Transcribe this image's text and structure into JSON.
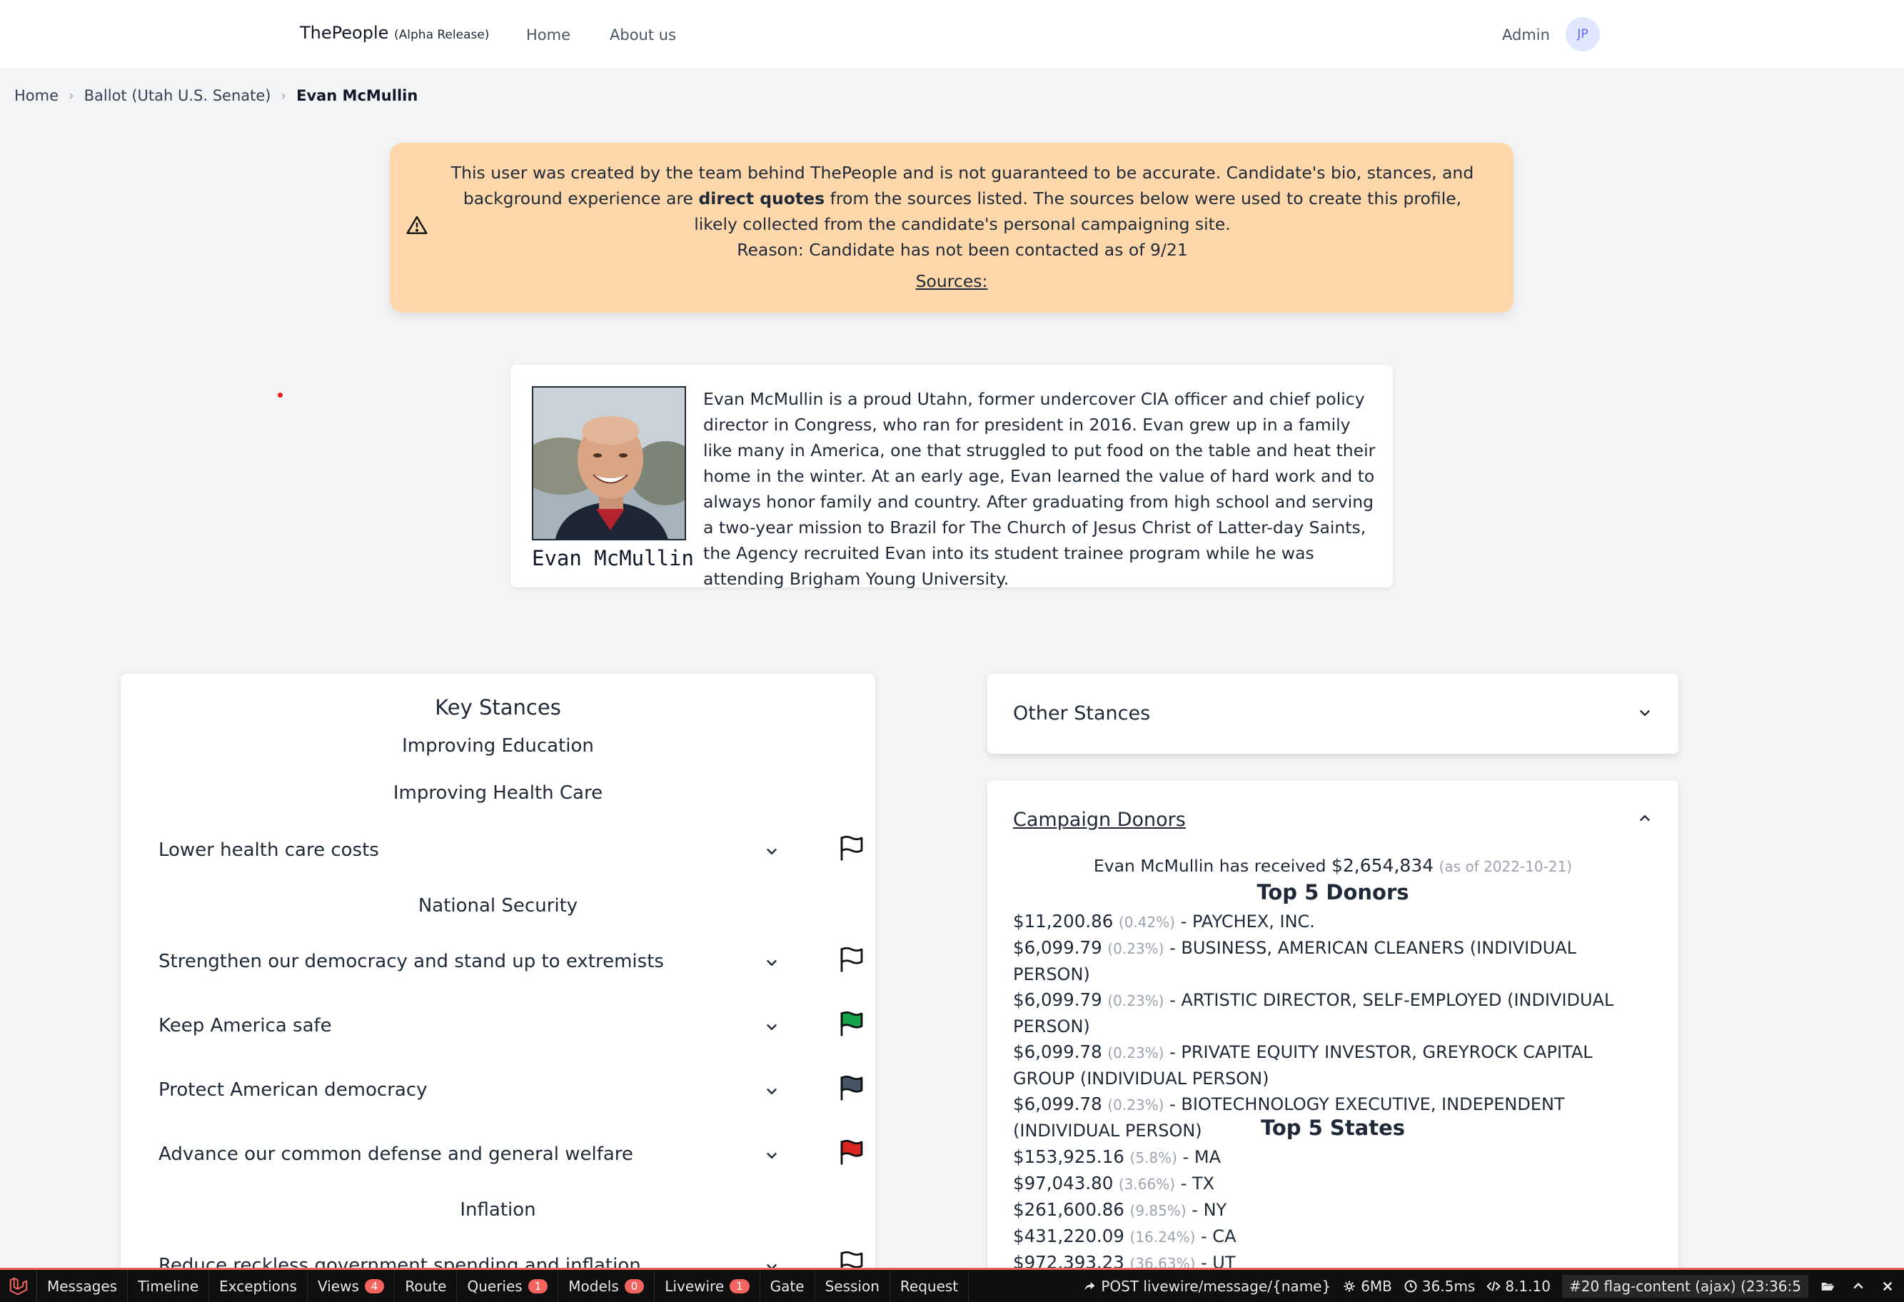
{
  "nav": {
    "brand": "ThePeople",
    "brand_tag": "(Alpha Release)",
    "links": [
      "Home",
      "About us"
    ],
    "admin": "Admin",
    "avatar": "JP"
  },
  "breadcrumb": [
    "Home",
    "Ballot (Utah U.S. Senate)",
    "Evan McMullin"
  ],
  "warning": {
    "part1": "This user was created by the team behind ThePeople and is not guaranteed to be accurate. Candidate's bio, stances, and background experience are ",
    "bold": "direct quotes",
    "part2": " from the sources listed. The sources below were used to create this profile, likely collected from the candidate's personal campaigning site.",
    "reason": "Reason: Candidate has not been contacted as of 9/21",
    "sources": "Sources:",
    "icon": "warning-triangle-icon"
  },
  "bio": {
    "name": "Evan McMullin",
    "text": "Evan McMullin is a proud Utahn, former undercover CIA officer and chief policy director in Congress, who ran for president in 2016. Evan grew up in a family like many in America, one that struggled to put food on the table and heat their home in the winter. At an early age, Evan learned the value of hard work and to always honor family and country. After graduating from high school and serving a two-year mission to Brazil for The Church of Jesus Christ of Latter-day Saints, the Agency recruited Evan into its student trainee program while he was attending Brigham Young University."
  },
  "key_stances": {
    "title": "Key Stances",
    "categories": [
      "Improving Education",
      "Improving Health Care",
      "National Security",
      "Inflation"
    ],
    "items": [
      {
        "label": "Lower health care costs",
        "flag_color": "#ffffff"
      },
      {
        "label": "Strengthen our democracy and stand up to extremists",
        "flag_color": "#ffffff"
      },
      {
        "label": "Keep America safe",
        "flag_color": "#16a34a"
      },
      {
        "label": "Protect American democracy",
        "flag_color": "#475569"
      },
      {
        "label": "Advance our common defense and general welfare",
        "flag_color": "#dc2626"
      },
      {
        "label": "Reduce reckless government spending and inflation",
        "flag_color": "#ffffff"
      }
    ]
  },
  "other_stances": {
    "title": "Other Stances"
  },
  "donors": {
    "title": "Campaign Donors",
    "received_prefix": "Evan McMullin has received ",
    "received_amount": "$2,654,834",
    "received_date": "(as of 2022-10-21)",
    "top_donors_title": "Top 5 Donors",
    "top_donors": [
      {
        "amount": "$11,200.86",
        "pct": "(0.42%)",
        "name": " - PAYCHEX, INC."
      },
      {
        "amount": "$6,099.79",
        "pct": "(0.23%)",
        "name": " - BUSINESS, AMERICAN CLEANERS (INDIVIDUAL PERSON)"
      },
      {
        "amount": "$6,099.79",
        "pct": "(0.23%)",
        "name": " - ARTISTIC DIRECTOR, SELF-EMPLOYED (INDIVIDUAL PERSON)"
      },
      {
        "amount": "$6,099.78",
        "pct": "(0.23%)",
        "name": " - PRIVATE EQUITY INVESTOR, GREYROCK CAPITAL GROUP (INDIVIDUAL PERSON)"
      },
      {
        "amount": "$6,099.78",
        "pct": "(0.23%)",
        "name": " - BIOTECHNOLOGY EXECUTIVE, INDEPENDENT (INDIVIDUAL PERSON)"
      }
    ],
    "top_states_title": "Top 5 States",
    "top_states": [
      {
        "amount": "$153,925.16",
        "pct": "(5.8%)",
        "name": " - MA"
      },
      {
        "amount": "$97,043.80",
        "pct": "(3.66%)",
        "name": " - TX"
      },
      {
        "amount": "$261,600.86",
        "pct": "(9.85%)",
        "name": " - NY"
      },
      {
        "amount": "$431,220.09",
        "pct": "(16.24%)",
        "name": " - CA"
      },
      {
        "amount": "$972,393.23",
        "pct": "(36.63%)",
        "name": " - UT"
      }
    ]
  },
  "debugbar": {
    "tabs": [
      {
        "label": "Messages",
        "badge": ""
      },
      {
        "label": "Timeline",
        "badge": ""
      },
      {
        "label": "Exceptions",
        "badge": ""
      },
      {
        "label": "Views",
        "badge": "4"
      },
      {
        "label": "Route",
        "badge": ""
      },
      {
        "label": "Queries",
        "badge": "1"
      },
      {
        "label": "Models",
        "badge": "0"
      },
      {
        "label": "Livewire",
        "badge": "1"
      },
      {
        "label": "Gate",
        "badge": ""
      },
      {
        "label": "Session",
        "badge": ""
      },
      {
        "label": "Request",
        "badge": ""
      }
    ],
    "route": "POST livewire/message/{name}",
    "memory": "6MB",
    "time": "36.5ms",
    "version": "8.1.10",
    "request": "#20 flag-content (ajax) (23:36:5"
  }
}
